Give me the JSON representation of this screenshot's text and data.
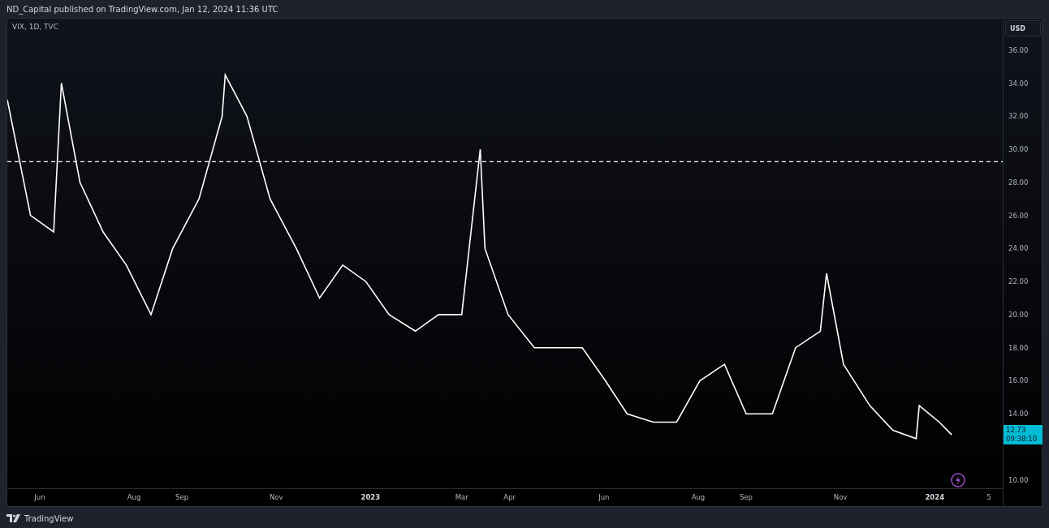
{
  "header": {
    "attribution": "ND_Capital published on TradingView.com, Jan 12, 2024 11:36 UTC"
  },
  "chart": {
    "symbol": "VIX, 1D, TVC",
    "currency_button": "USD",
    "last_price": "12.73",
    "countdown": "09:38:10",
    "chart_data": {
      "type": "line",
      "xlim": [
        "2022-05-11",
        "2024-02-14"
      ],
      "ylim": [
        9.5,
        37.9
      ],
      "xticks": [
        {
          "value": "2022-06-01",
          "label": "Jun"
        },
        {
          "value": "2022-08-01",
          "label": "Aug"
        },
        {
          "value": "2022-09-01",
          "label": "Sep"
        },
        {
          "value": "2022-11-01",
          "label": "Nov"
        },
        {
          "value": "2023-01-01",
          "label": "2023"
        },
        {
          "value": "2023-03-01",
          "label": "Mar"
        },
        {
          "value": "2023-04-01",
          "label": "Apr"
        },
        {
          "value": "2023-06-01",
          "label": "Jun"
        },
        {
          "value": "2023-08-01",
          "label": "Aug"
        },
        {
          "value": "2023-09-01",
          "label": "Sep"
        },
        {
          "value": "2023-11-01",
          "label": "Nov"
        },
        {
          "value": "2024-01-01",
          "label": "2024"
        },
        {
          "value": "2024-02-05",
          "label": "5"
        }
      ],
      "yticks": [
        {
          "value": 10,
          "label": "10.00"
        },
        {
          "value": 14,
          "label": "14.00"
        },
        {
          "value": 16,
          "label": "16.00"
        },
        {
          "value": 18,
          "label": "18.00"
        },
        {
          "value": 20,
          "label": "20.00"
        },
        {
          "value": 22,
          "label": "22.00"
        },
        {
          "value": 24,
          "label": "24.00"
        },
        {
          "value": 26,
          "label": "26.00"
        },
        {
          "value": 28,
          "label": "28.00"
        },
        {
          "value": 30,
          "label": "30.00"
        },
        {
          "value": 32,
          "label": "32.00"
        },
        {
          "value": 34,
          "label": "34.00"
        },
        {
          "value": 36,
          "label": "36.00"
        }
      ],
      "x": [
        "2022-05-11",
        "2022-05-26",
        "2022-06-10",
        "2022-06-15",
        "2022-06-27",
        "2022-07-12",
        "2022-07-27",
        "2022-08-12",
        "2022-08-26",
        "2022-09-12",
        "2022-09-27",
        "2022-09-29",
        "2022-10-13",
        "2022-10-28",
        "2022-11-14",
        "2022-11-29",
        "2022-12-14",
        "2022-12-29",
        "2023-01-13",
        "2023-01-30",
        "2023-02-14",
        "2023-03-01",
        "2023-03-13",
        "2023-03-16",
        "2023-03-31",
        "2023-04-17",
        "2023-05-02",
        "2023-05-18",
        "2023-06-02",
        "2023-06-16",
        "2023-07-03",
        "2023-07-18",
        "2023-08-02",
        "2023-08-18",
        "2023-09-01",
        "2023-09-18",
        "2023-10-03",
        "2023-10-19",
        "2023-10-23",
        "2023-11-03",
        "2023-11-20",
        "2023-12-05",
        "2023-12-20",
        "2023-12-22",
        "2024-01-04",
        "2024-01-12"
      ],
      "series": [
        {
          "color": "#ffffff",
          "values": [
            33,
            26,
            25,
            34,
            28,
            25,
            23,
            20,
            24,
            27,
            32,
            34.5,
            32,
            27,
            24,
            21,
            23,
            22,
            20,
            19,
            20,
            20,
            30,
            24,
            20,
            18,
            18,
            18,
            16,
            14,
            13.5,
            13.5,
            16,
            17,
            14,
            14,
            18,
            19,
            22.5,
            17,
            14.5,
            13,
            12.5,
            14.5,
            13.5,
            12.73
          ]
        }
      ],
      "ref_lines": [
        {
          "axis": "y",
          "value": 29.25
        }
      ]
    }
  },
  "footer": {
    "brand": "TradingView"
  }
}
